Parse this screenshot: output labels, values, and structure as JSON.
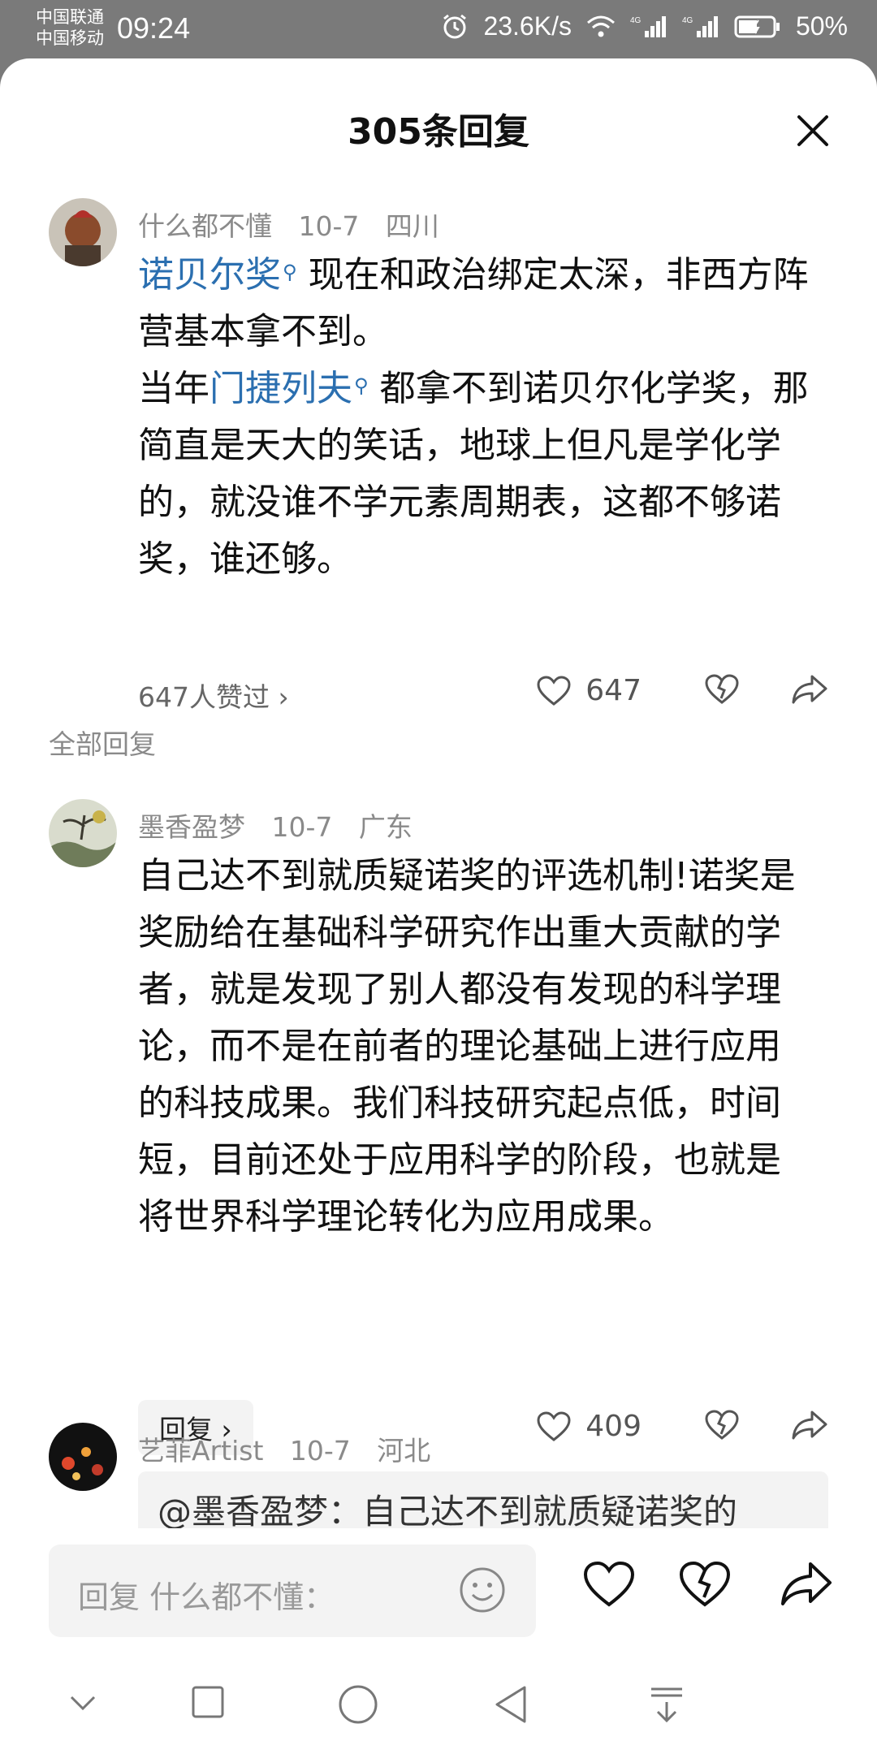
{
  "status_bar": {
    "carrier_1": "中国联通",
    "carrier_2": "中国移动",
    "time": "09:24",
    "net_speed": "23.6K/s",
    "net_type_1": "4G",
    "net_type_2": "4G",
    "battery": "50%",
    "icons": [
      "alarm-icon",
      "wifi-icon",
      "signal-icon",
      "battery-icon"
    ]
  },
  "sheet": {
    "title": "305条回复",
    "close_icon": "close-icon"
  },
  "main_comment": {
    "user": "什么都不懂",
    "date": "10-7",
    "location": "四川",
    "link_1": "诺贝尔奖",
    "text_1": " 现在和政治绑定太深，非西方阵营基本拿不到。",
    "text_2": "当年",
    "link_2": "门捷列夫",
    "text_3": " 都拿不到诺贝尔化学奖，那简直是天大的笑话，地球上但凡是学化学的，就没谁不学元素周期表，这都不够诺奖，谁还够。",
    "liked_by": "647人赞过 ›",
    "like_count": "647"
  },
  "section_label": "全部回复",
  "replies": [
    {
      "user": "墨香盈梦",
      "date": "10-7",
      "location": "广东",
      "text": "自己达不到就质疑诺奖的评选机制!诺奖是奖励给在基础科学研究作出重大贡献的学者，就是发现了别人都没有发现的科学理论，而不是在前者的理论基础上进行应用的科技成果。我们科技研究起点低，时间短，目前还处于应用科学的阶段，也就是将世界科学理论转化为应用成果。",
      "reply_label": "回复 ›",
      "like_count": "409"
    },
    {
      "user": "艺菲Artist",
      "date": "10-7",
      "location": "河北",
      "quote": "@墨香盈梦：自己达不到就质疑诺奖的"
    }
  ],
  "input_bar": {
    "placeholder": "回复 什么都不懂："
  },
  "colors": {
    "link": "#2b6fb0",
    "meta": "#8a8a8a",
    "backdrop": "#7a7a7a"
  }
}
